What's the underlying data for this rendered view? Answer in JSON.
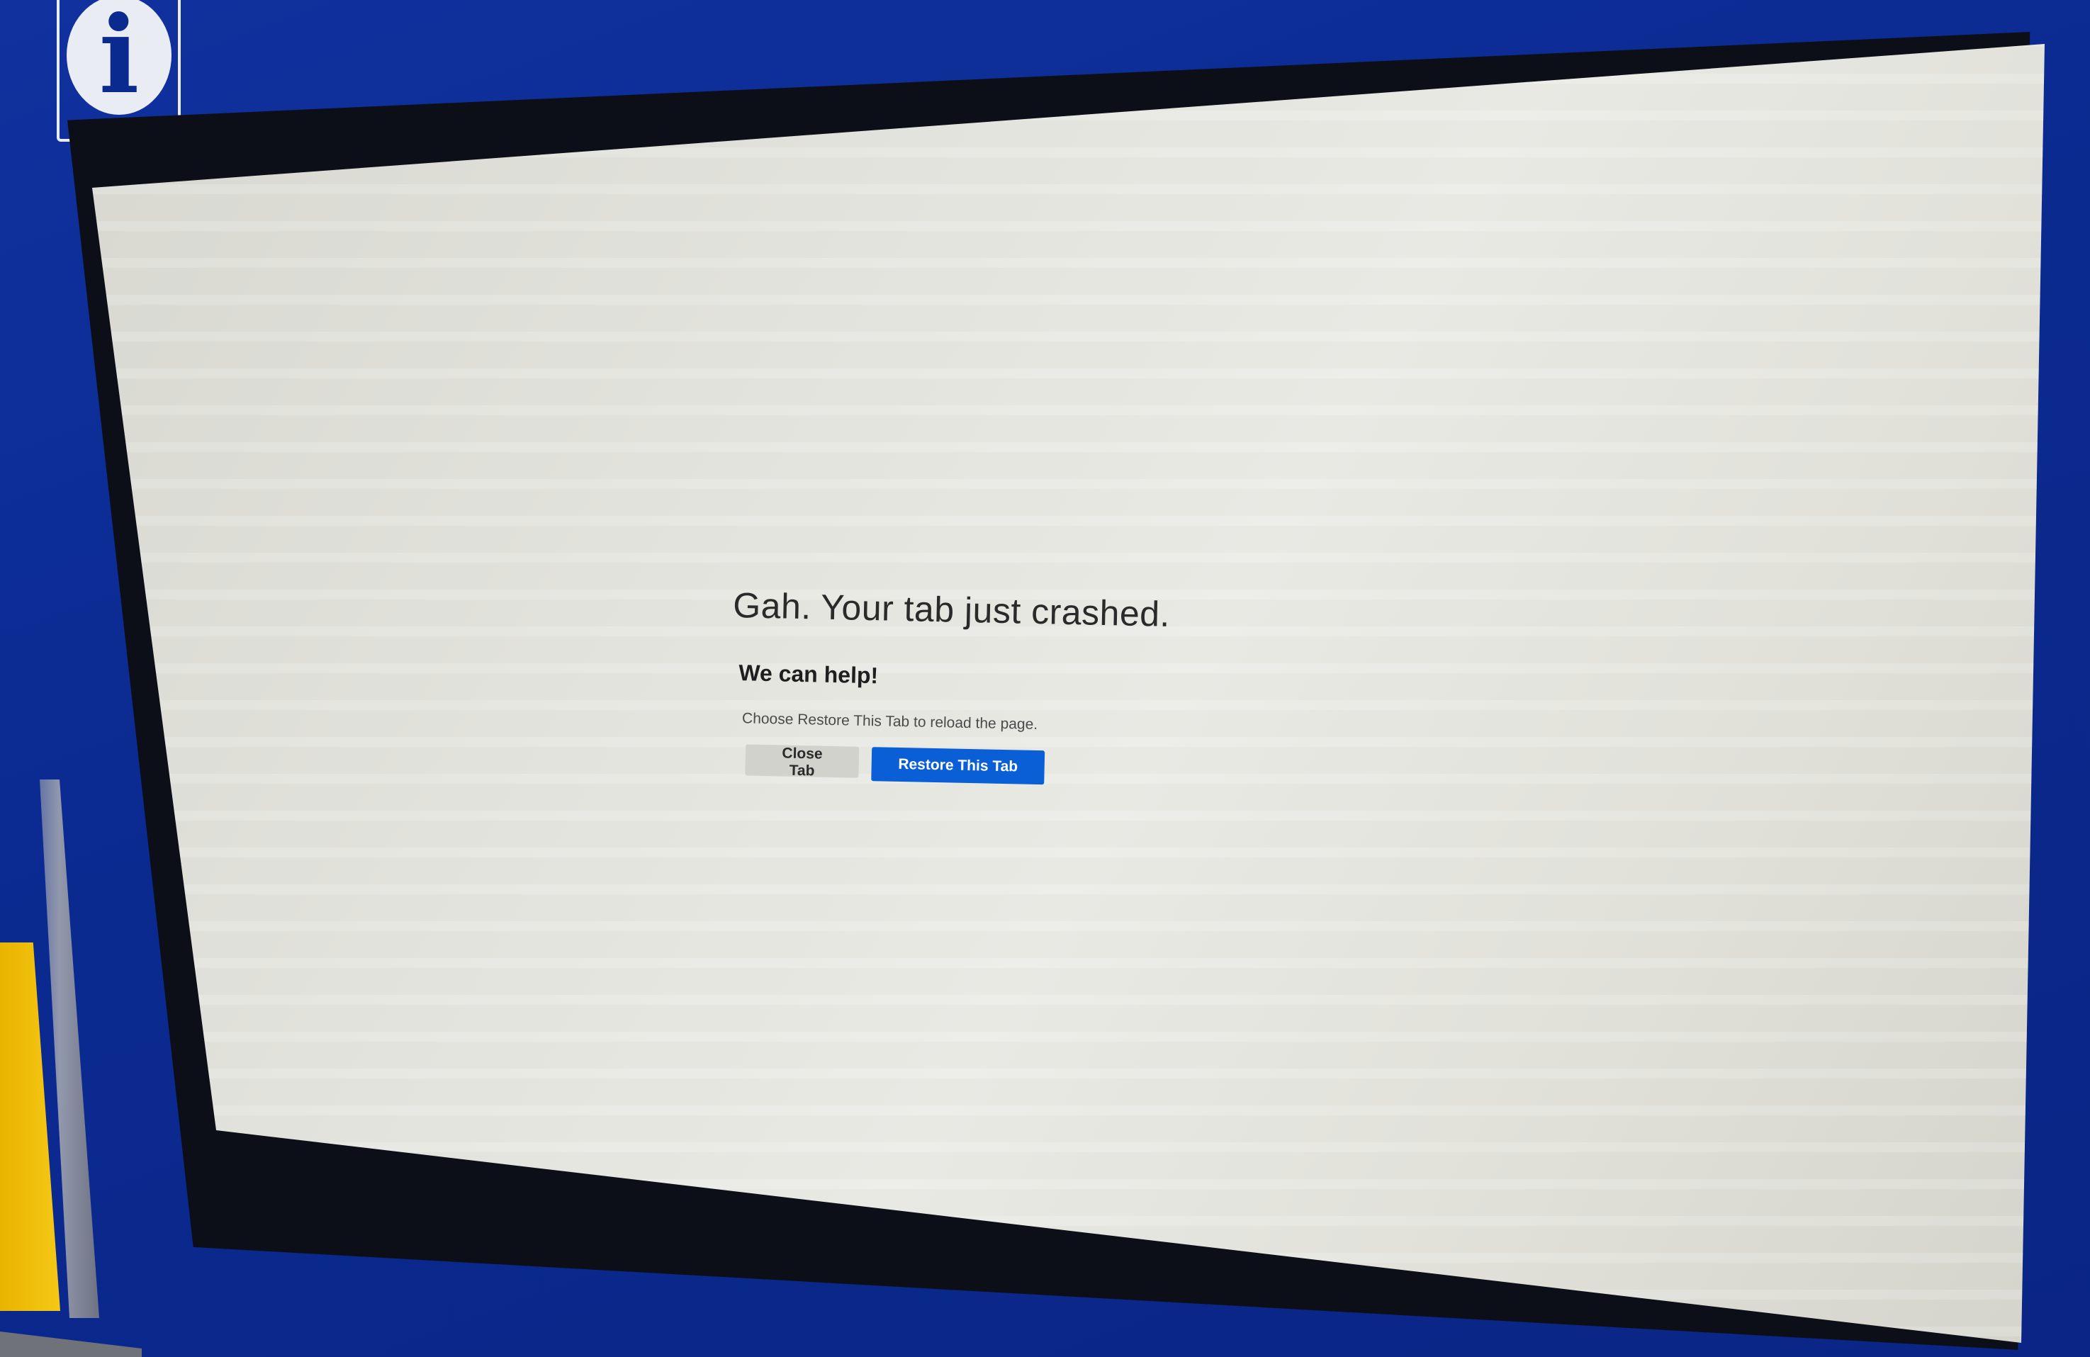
{
  "kiosk": {
    "info_icon": "info-icon",
    "colors": {
      "frame": "#0b2a90",
      "screen": "#e4e4de",
      "accent_button": "#0a5fd6",
      "secondary_button": "#d2d2cc",
      "side_panel": "#f2c311"
    }
  },
  "crash_page": {
    "title": "Gah. Your tab just crashed.",
    "subtitle": "We can help!",
    "description": "Choose Restore This Tab to reload the page.",
    "buttons": {
      "close_label": "Close Tab",
      "restore_label": "Restore This Tab"
    }
  }
}
